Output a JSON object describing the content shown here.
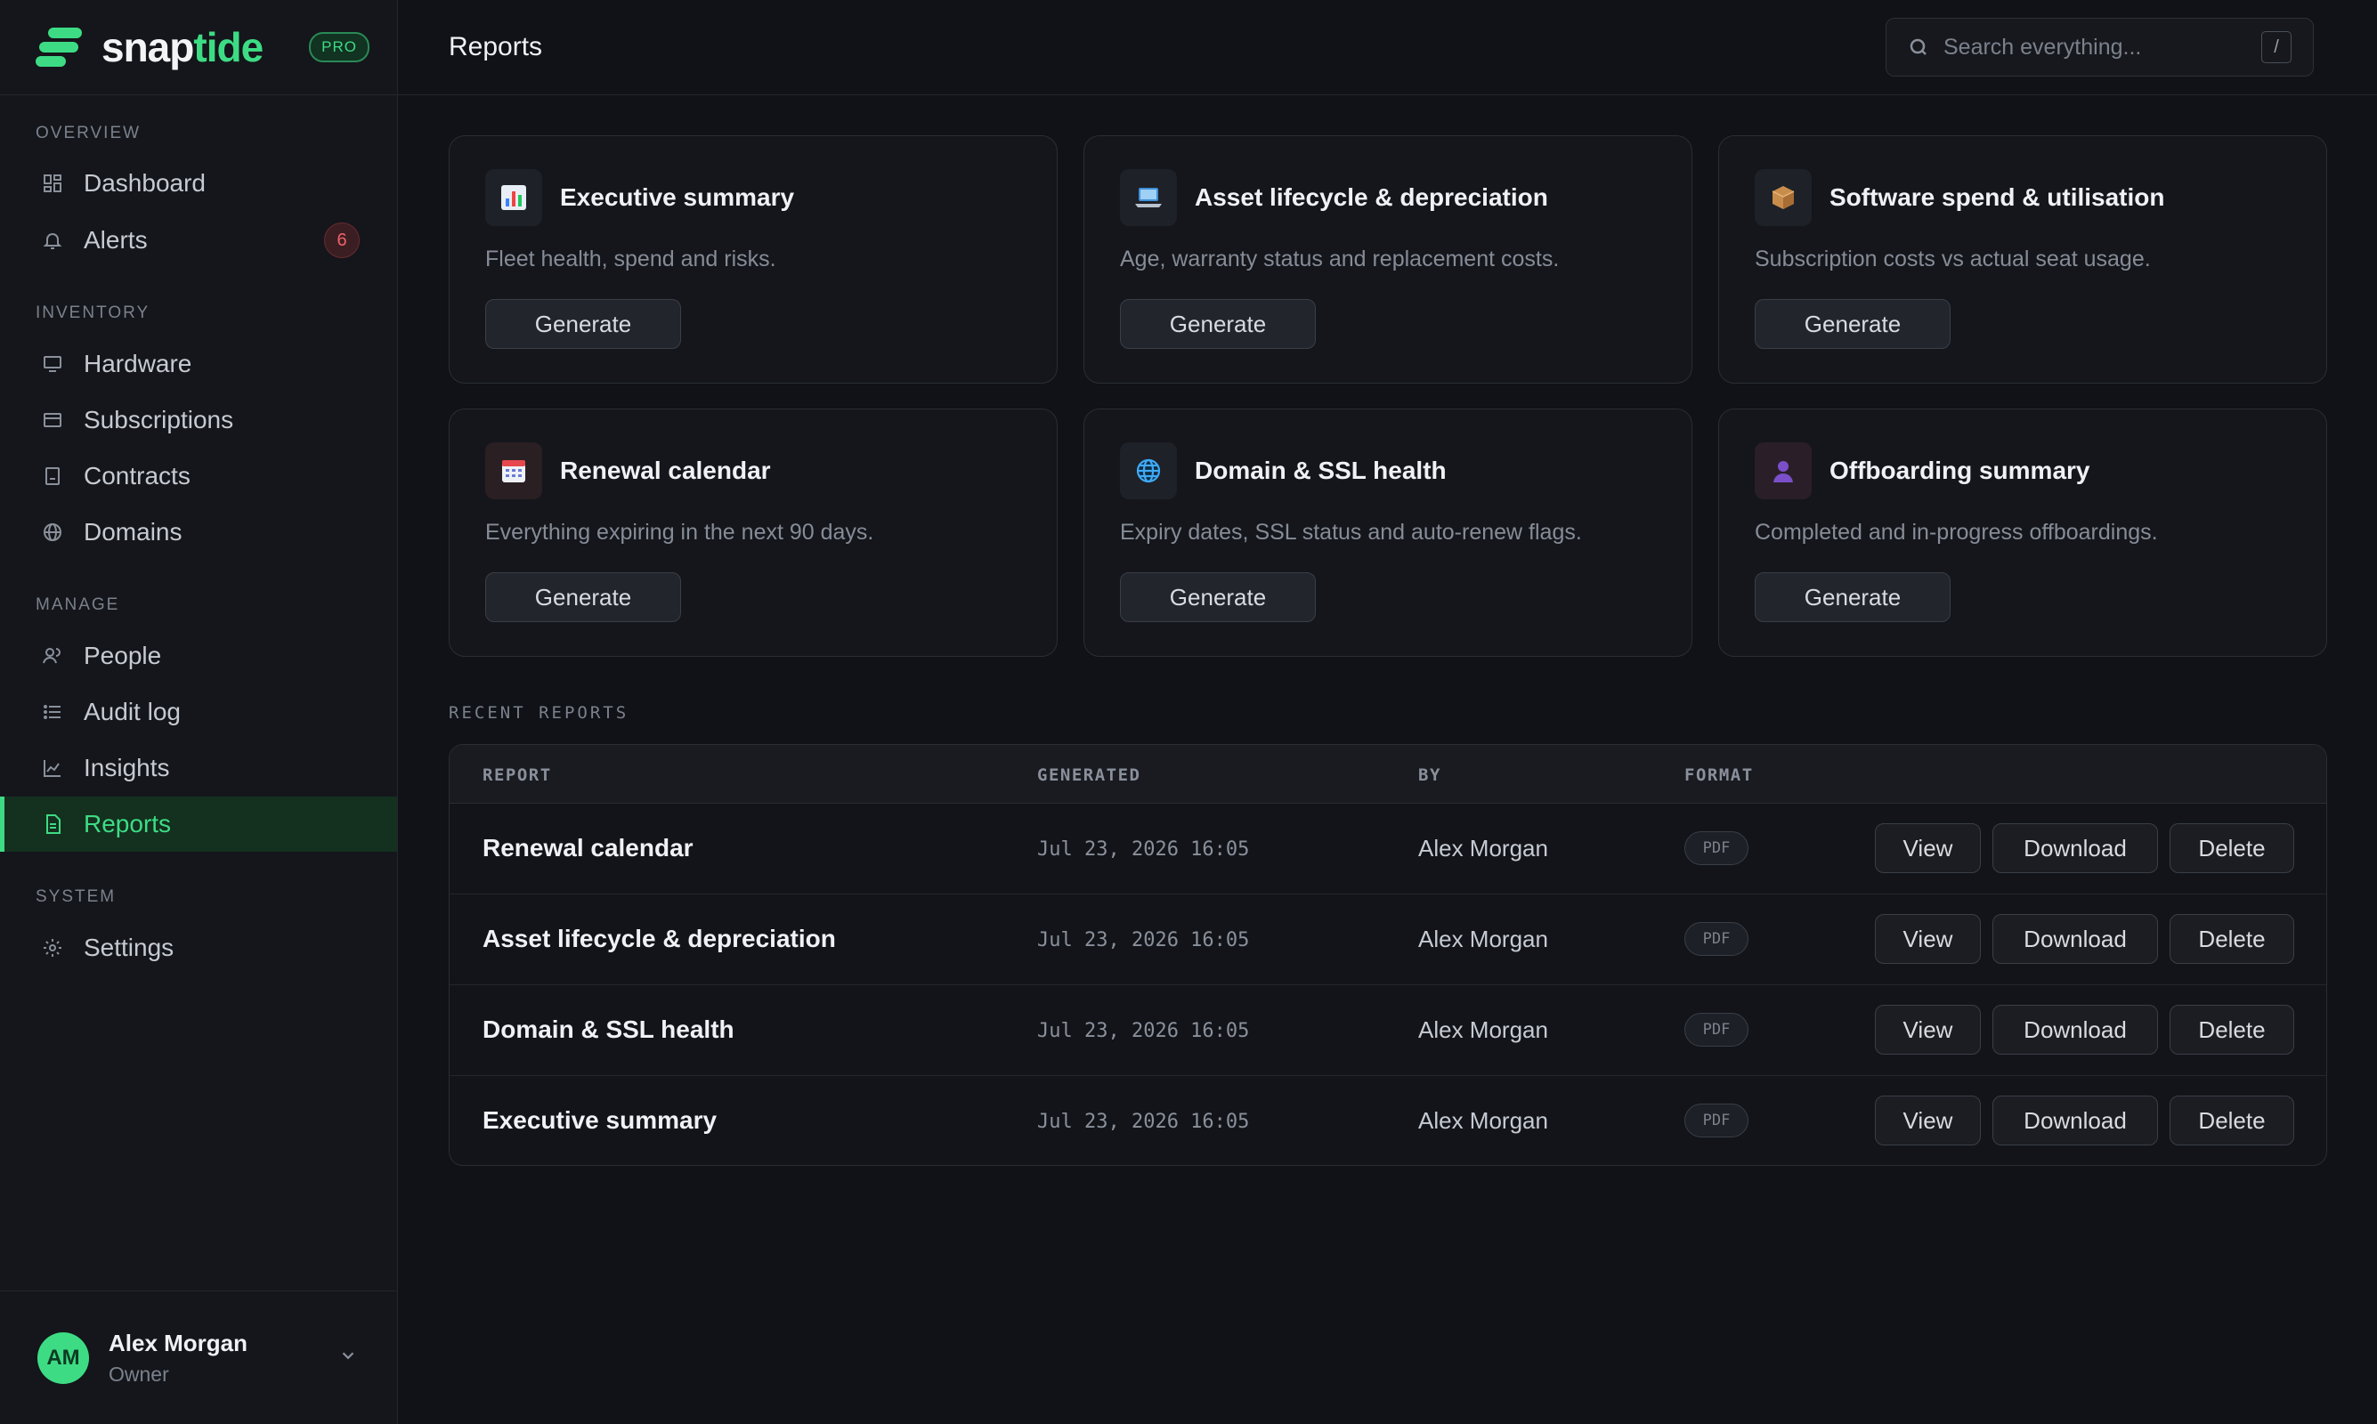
{
  "brand": {
    "name_main": "snap",
    "name_accent": "tide",
    "badge": "PRO",
    "accent_color": "#3ddc84"
  },
  "sidebar": {
    "sections": [
      {
        "label": "OVERVIEW"
      },
      {
        "label": "INVENTORY"
      },
      {
        "label": "MANAGE"
      },
      {
        "label": "SYSTEM"
      }
    ],
    "items": [
      {
        "label": "Dashboard",
        "icon": "grid-icon"
      },
      {
        "label": "Alerts",
        "icon": "bell-icon",
        "badge": "6"
      },
      {
        "label": "Hardware",
        "icon": "monitor-icon"
      },
      {
        "label": "Subscriptions",
        "icon": "card-icon"
      },
      {
        "label": "Contracts",
        "icon": "document-icon"
      },
      {
        "label": "Domains",
        "icon": "globe-icon"
      },
      {
        "label": "People",
        "icon": "people-icon"
      },
      {
        "label": "Audit log",
        "icon": "list-icon"
      },
      {
        "label": "Insights",
        "icon": "chart-icon"
      },
      {
        "label": "Reports",
        "icon": "report-icon",
        "active": true
      },
      {
        "label": "Settings",
        "icon": "gear-icon"
      }
    ]
  },
  "user": {
    "initials": "AM",
    "name": "Alex Morgan",
    "role": "Owner"
  },
  "header": {
    "title": "Reports"
  },
  "search": {
    "placeholder": "Search everything...",
    "shortcut": "/"
  },
  "report_cards": [
    {
      "title": "Executive summary",
      "description": "Fleet health, spend and risks.",
      "icon": "bar-chart-icon",
      "button": "Generate"
    },
    {
      "title": "Asset lifecycle & depreciation",
      "description": "Age, warranty status and replacement costs.",
      "icon": "laptop-icon",
      "button": "Generate"
    },
    {
      "title": "Software spend & utilisation",
      "description": "Subscription costs vs actual seat usage.",
      "icon": "package-icon",
      "button": "Generate"
    },
    {
      "title": "Renewal calendar",
      "description": "Everything expiring in the next 90 days.",
      "icon": "calendar-icon",
      "button": "Generate"
    },
    {
      "title": "Domain & SSL health",
      "description": "Expiry dates, SSL status and auto-renew flags.",
      "icon": "globe-icon",
      "button": "Generate"
    },
    {
      "title": "Offboarding summary",
      "description": "Completed and in-progress offboardings.",
      "icon": "person-icon",
      "button": "Generate"
    }
  ],
  "recent": {
    "label": "RECENT REPORTS",
    "columns": [
      "REPORT",
      "GENERATED",
      "BY",
      "FORMAT"
    ],
    "actions": {
      "view": "View",
      "download": "Download",
      "delete": "Delete"
    },
    "rows": [
      {
        "report": "Renewal calendar",
        "generated": "Jul 23, 2026 16:05",
        "by": "Alex Morgan",
        "format": "PDF"
      },
      {
        "report": "Asset lifecycle & depreciation",
        "generated": "Jul 23, 2026 16:05",
        "by": "Alex Morgan",
        "format": "PDF"
      },
      {
        "report": "Domain & SSL health",
        "generated": "Jul 23, 2026 16:05",
        "by": "Alex Morgan",
        "format": "PDF"
      },
      {
        "report": "Executive summary",
        "generated": "Jul 23, 2026 16:05",
        "by": "Alex Morgan",
        "format": "PDF"
      }
    ]
  }
}
